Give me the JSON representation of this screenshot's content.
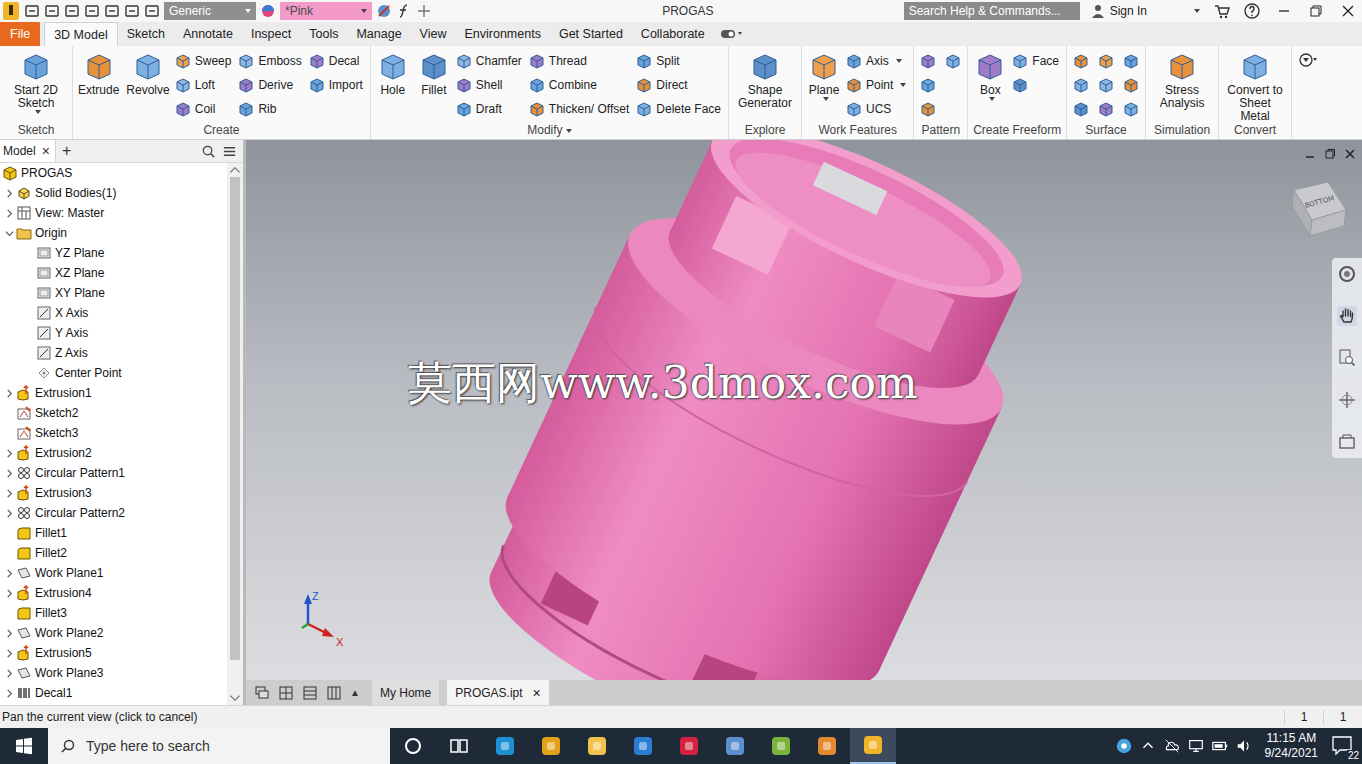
{
  "window": {
    "title": "PROGAS"
  },
  "quick_access": {
    "material": "Generic",
    "appearance": "*Pink"
  },
  "search": {
    "placeholder": "Search Help & Commands..."
  },
  "account": {
    "label": "Sign In"
  },
  "ribbon_tabs": [
    {
      "label": "File",
      "selected": false,
      "kind": "file"
    },
    {
      "label": "3D Model",
      "selected": true,
      "kind": "tab"
    },
    {
      "label": "Sketch",
      "selected": false,
      "kind": "tab"
    },
    {
      "label": "Annotate",
      "selected": false,
      "kind": "tab"
    },
    {
      "label": "Inspect",
      "selected": false,
      "kind": "tab"
    },
    {
      "label": "Tools",
      "selected": false,
      "kind": "tab"
    },
    {
      "label": "Manage",
      "selected": false,
      "kind": "tab"
    },
    {
      "label": "View",
      "selected": false,
      "kind": "tab"
    },
    {
      "label": "Environments",
      "selected": false,
      "kind": "tab"
    },
    {
      "label": "Get Started",
      "selected": false,
      "kind": "tab"
    },
    {
      "label": "Collaborate",
      "selected": false,
      "kind": "tab"
    }
  ],
  "ribbon_groups": [
    {
      "label": "Sketch",
      "dropdown": false,
      "columns": [
        {
          "kind": "large",
          "tools": [
            {
              "label": "Start 2D Sketch",
              "dropdown": true
            }
          ]
        }
      ]
    },
    {
      "label": "Create",
      "dropdown": false,
      "columns": [
        {
          "kind": "large",
          "tools": [
            {
              "label": "Extrude",
              "dropdown": false
            },
            {
              "label": "Revolve",
              "dropdown": false
            }
          ]
        },
        {
          "kind": "small",
          "tools": [
            {
              "label": "Sweep",
              "dropdown": false
            },
            {
              "label": "Loft",
              "dropdown": false
            },
            {
              "label": "Coil",
              "dropdown": false
            }
          ]
        },
        {
          "kind": "small",
          "tools": [
            {
              "label": "Emboss",
              "dropdown": false
            },
            {
              "label": "Derive",
              "dropdown": false
            },
            {
              "label": "Rib",
              "dropdown": false
            }
          ]
        },
        {
          "kind": "small",
          "tools": [
            {
              "label": "Decal",
              "dropdown": false
            },
            {
              "label": "Import",
              "dropdown": false
            }
          ]
        }
      ]
    },
    {
      "label": "Modify",
      "dropdown": true,
      "columns": [
        {
          "kind": "large",
          "tools": [
            {
              "label": "Hole",
              "dropdown": false
            },
            {
              "label": "Fillet",
              "dropdown": false
            }
          ]
        },
        {
          "kind": "small",
          "tools": [
            {
              "label": "Chamfer",
              "dropdown": false
            },
            {
              "label": "Shell",
              "dropdown": false
            },
            {
              "label": "Draft",
              "dropdown": false
            }
          ]
        },
        {
          "kind": "small",
          "tools": [
            {
              "label": "Thread",
              "dropdown": false
            },
            {
              "label": "Combine",
              "dropdown": false
            },
            {
              "label": "Thicken/ Offset",
              "dropdown": false
            }
          ]
        },
        {
          "kind": "small",
          "tools": [
            {
              "label": "Split",
              "dropdown": false
            },
            {
              "label": "Direct",
              "dropdown": false
            },
            {
              "label": "Delete Face",
              "dropdown": false
            }
          ]
        }
      ]
    },
    {
      "label": "Explore",
      "dropdown": false,
      "columns": [
        {
          "kind": "large",
          "tools": [
            {
              "label": "Shape Generator",
              "dropdown": false
            }
          ]
        }
      ]
    },
    {
      "label": "Work Features",
      "dropdown": false,
      "columns": [
        {
          "kind": "large",
          "tools": [
            {
              "label": "Plane",
              "dropdown": true
            }
          ]
        },
        {
          "kind": "small",
          "tools": [
            {
              "label": "Axis",
              "dropdown": true
            },
            {
              "label": "Point",
              "dropdown": true
            },
            {
              "label": "UCS",
              "dropdown": false
            }
          ]
        }
      ]
    },
    {
      "label": "Pattern",
      "dropdown": false,
      "columns": [
        {
          "kind": "icon",
          "tools": [
            {
              "dropdown": false
            },
            {
              "dropdown": false
            },
            {
              "dropdown": false
            }
          ]
        },
        {
          "kind": "icon",
          "tools": [
            {
              "dropdown": false
            }
          ]
        }
      ]
    },
    {
      "label": "Create Freeform",
      "dropdown": false,
      "columns": [
        {
          "kind": "large",
          "tools": [
            {
              "label": "Box",
              "dropdown": true
            }
          ]
        },
        {
          "kind": "small",
          "tools": [
            {
              "label": "Face",
              "dropdown": false
            },
            {
              "dropdown": false
            }
          ]
        }
      ]
    },
    {
      "label": "Surface",
      "dropdown": false,
      "columns": [
        {
          "kind": "icon",
          "tools": [
            {
              "dropdown": false
            },
            {
              "dropdown": false
            },
            {
              "dropdown": false
            }
          ]
        },
        {
          "kind": "icon",
          "tools": [
            {
              "dropdown": false
            },
            {
              "dropdown": false
            },
            {
              "dropdown": false
            }
          ]
        },
        {
          "kind": "icon",
          "tools": [
            {
              "dropdown": false
            },
            {
              "dropdown": false
            },
            {
              "dropdown": false
            }
          ]
        }
      ]
    },
    {
      "label": "Simulation",
      "dropdown": false,
      "columns": [
        {
          "kind": "large",
          "tools": [
            {
              "label": "Stress Analysis",
              "dropdown": false
            }
          ]
        }
      ]
    },
    {
      "label": "Convert",
      "dropdown": false,
      "columns": [
        {
          "kind": "large",
          "tools": [
            {
              "label": "Convert to Sheet Metal",
              "dropdown": false
            }
          ]
        }
      ]
    }
  ],
  "browser": {
    "title": "Model",
    "close": "×",
    "add": "+",
    "scrollbar": {
      "level": 0.94
    },
    "root": {
      "label": "PROGAS",
      "kind": "part",
      "expandable": false,
      "expanded": true,
      "children": [
        {
          "label": "Solid Bodies(1)",
          "kind": "bodies",
          "expandable": true,
          "expanded": false
        },
        {
          "label": "View: Master",
          "kind": "view",
          "expandable": true,
          "expanded": false
        },
        {
          "label": "Origin",
          "kind": "folder",
          "expandable": true,
          "expanded": true,
          "children": [
            {
              "label": "YZ Plane",
              "kind": "plane",
              "expandable": false,
              "expanded": false
            },
            {
              "label": "XZ Plane",
              "kind": "plane",
              "expandable": false,
              "expanded": false
            },
            {
              "label": "XY Plane",
              "kind": "plane",
              "expandable": false,
              "expanded": false
            },
            {
              "label": "X Axis",
              "kind": "axis",
              "expandable": false,
              "expanded": false
            },
            {
              "label": "Y Axis",
              "kind": "axis",
              "expandable": false,
              "expanded": false
            },
            {
              "label": "Z Axis",
              "kind": "axis",
              "expandable": false,
              "expanded": false
            },
            {
              "label": "Center Point",
              "kind": "point",
              "expandable": false,
              "expanded": false
            }
          ]
        },
        {
          "label": "Extrusion1",
          "kind": "extrusion",
          "expandable": true,
          "expanded": false
        },
        {
          "label": "Sketch2",
          "kind": "sketch",
          "expandable": false,
          "expanded": false
        },
        {
          "label": "Sketch3",
          "kind": "sketch",
          "expandable": false,
          "expanded": false
        },
        {
          "label": "Extrusion2",
          "kind": "extrusion",
          "expandable": true,
          "expanded": false
        },
        {
          "label": "Circular Pattern1",
          "kind": "pattern",
          "expandable": true,
          "expanded": false
        },
        {
          "label": "Extrusion3",
          "kind": "extrusion",
          "expandable": true,
          "expanded": false
        },
        {
          "label": "Circular Pattern2",
          "kind": "pattern",
          "expandable": true,
          "expanded": false
        },
        {
          "label": "Fillet1",
          "kind": "fillet",
          "expandable": false,
          "expanded": false
        },
        {
          "label": "Fillet2",
          "kind": "fillet",
          "expandable": false,
          "expanded": false
        },
        {
          "label": "Work Plane1",
          "kind": "workplane",
          "expandable": true,
          "expanded": false
        },
        {
          "label": "Extrusion4",
          "kind": "extrusion",
          "expandable": true,
          "expanded": false
        },
        {
          "label": "Fillet3",
          "kind": "fillet",
          "expandable": false,
          "expanded": false
        },
        {
          "label": "Work Plane2",
          "kind": "workplane",
          "expandable": true,
          "expanded": false
        },
        {
          "label": "Extrusion5",
          "kind": "extrusion",
          "expandable": true,
          "expanded": false
        },
        {
          "label": "Work Plane3",
          "kind": "workplane",
          "expandable": true,
          "expanded": false
        },
        {
          "label": "Decal1",
          "kind": "decal",
          "expandable": true,
          "expanded": false
        }
      ]
    }
  },
  "viewport": {
    "watermark": "莫西网www.3dmox.com",
    "viewcube": "BOTTOM",
    "axes": [
      "Z",
      "X"
    ]
  },
  "document_tabs": {
    "layout_up": "▲",
    "tabs": [
      {
        "label": "My Home",
        "selected": false,
        "close": ""
      },
      {
        "label": "PROGAS.ipt",
        "selected": true,
        "close": "×"
      }
    ]
  },
  "status_bar": {
    "message": "Pan the current view (click to cancel)",
    "counts": [
      "1",
      "1"
    ]
  },
  "taskbar": {
    "search": "Type here to search",
    "apps": [
      {
        "color": "#1e90d6",
        "active": false
      },
      {
        "color": "#e3a21a",
        "active": false
      },
      {
        "color": "#f2c14e",
        "active": false
      },
      {
        "color": "#2b7cd3",
        "active": false
      },
      {
        "color": "#d4213d",
        "active": false
      },
      {
        "color": "#5a8fd0",
        "active": false
      },
      {
        "color": "#79b33a",
        "active": false
      },
      {
        "color": "#e5892f",
        "active": false
      },
      {
        "color": "#f0b429",
        "active": true
      }
    ],
    "time": "11:15 AM",
    "date": "9/24/2021",
    "notifications": "22"
  }
}
